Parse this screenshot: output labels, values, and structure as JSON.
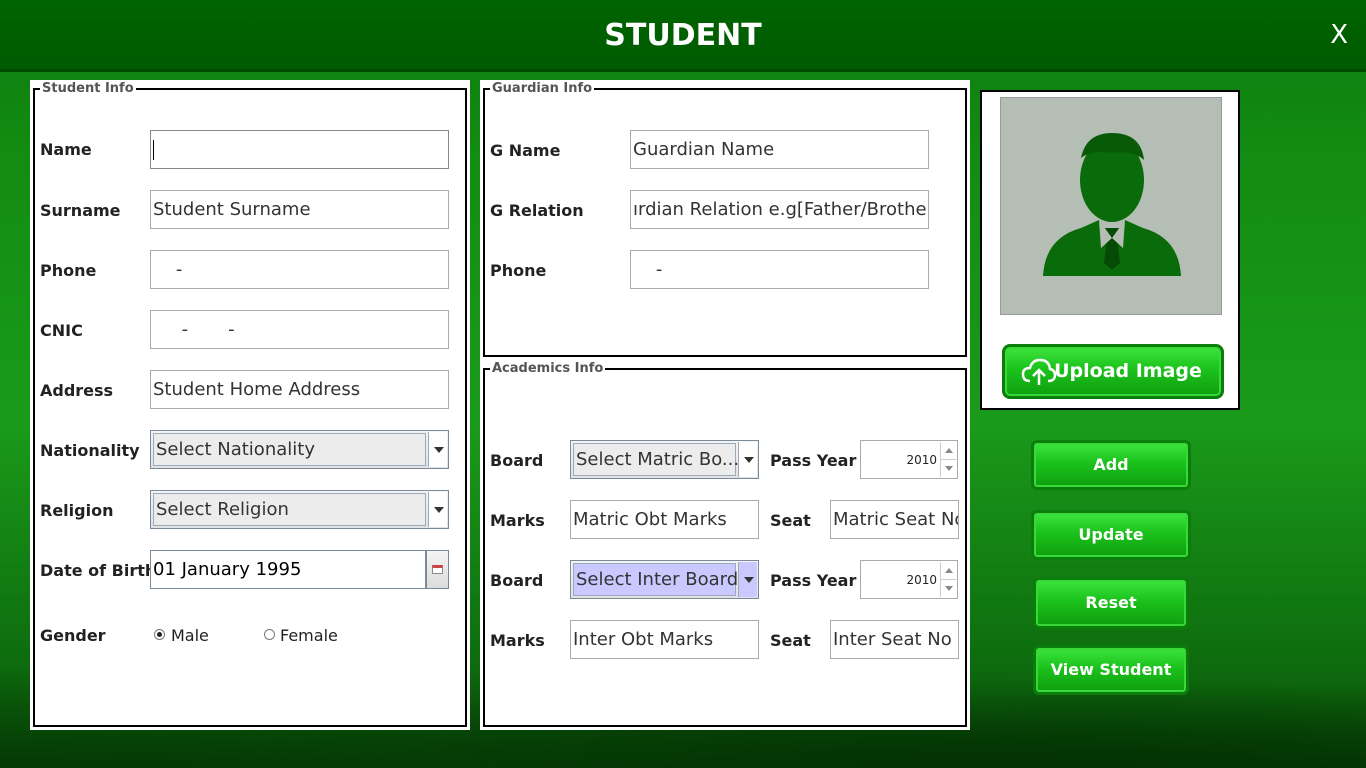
{
  "window": {
    "title": "STUDENT",
    "close_label": "X"
  },
  "student_info": {
    "legend": "Student Info",
    "name_label": "Name",
    "name_value": "",
    "surname_label": "Surname",
    "surname_placeholder": "Student Surname",
    "phone_label": "Phone",
    "phone_value": "    -",
    "cnic_label": "CNIC",
    "cnic_value": "     -       -",
    "address_label": "Address",
    "address_placeholder": "Student Home Address",
    "nationality_label": "Nationality",
    "nationality_value": "Select Nationality",
    "religion_label": "Religion",
    "religion_value": "Select Religion",
    "dob_label": "Date of Birth",
    "dob_value": "01 January 1995",
    "gender_label": "Gender",
    "gender_male": "Male",
    "gender_female": "Female",
    "gender_selected": "Male"
  },
  "guardian_info": {
    "legend": "Guardian Info",
    "gname_label": "G Name",
    "gname_placeholder": "Guardian Name",
    "grelation_label": "G Relation",
    "grelation_placeholder": "ırdian Relation e.g[Father/Brother]",
    "phone_label": "Phone",
    "phone_value": "    -"
  },
  "academics_info": {
    "legend": "Academics Info",
    "board_label": "Board",
    "matric_board_value": "Select Matric Bo...",
    "pass_year_label": "Pass Year",
    "matric_pass_year": "2010",
    "marks_label": "Marks",
    "matric_marks_placeholder": "Matric Obt Marks",
    "seat_label": "Seat",
    "matric_seat_placeholder": "Matric Seat No",
    "inter_board_value": "Select Inter Board",
    "inter_pass_year": "2010",
    "inter_marks_placeholder": "Inter Obt Marks",
    "inter_seat_placeholder": "Inter Seat No"
  },
  "photo": {
    "upload_label": "Upload Image"
  },
  "actions": {
    "add": "Add",
    "update": "Update",
    "reset": "Reset",
    "view": "View Student"
  }
}
